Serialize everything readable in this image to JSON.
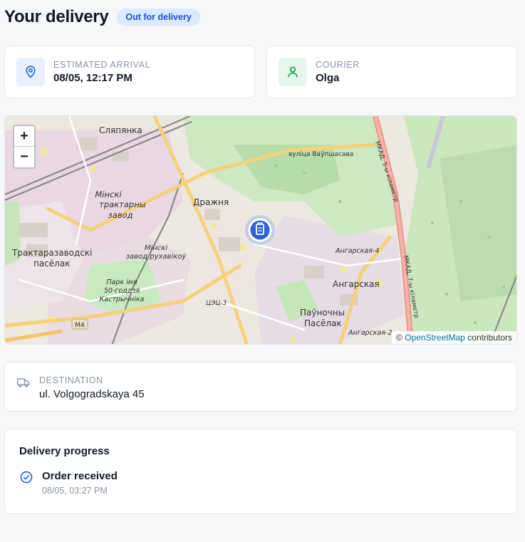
{
  "header": {
    "title": "Your delivery",
    "status": "Out for delivery"
  },
  "arrival": {
    "label": "ESTIMATED ARRIVAL",
    "value": "08/05, 12:17 PM",
    "icon": "map-pin-icon"
  },
  "courier": {
    "label": "COURIER",
    "value": "Olga",
    "icon": "user-icon"
  },
  "map": {
    "zoom_in": "+",
    "zoom_out": "−",
    "attribution_prefix": "©",
    "attribution_link": "OpenStreetMap",
    "attribution_suffix": "contributors",
    "labels": {
      "slyapyanka": "Сляпянка",
      "street": "вуліца Ваўпшасава",
      "mkad5": "МКАД, 5-ы кіламетр",
      "mkad7": "МКАД, 7-ы кіламетр",
      "tractor1": "Мінскі",
      "tractor2": "трактарны",
      "tractor3": "завод",
      "drazhnia": "Дражня",
      "traktar1": "Трактаразаводскі",
      "traktar2": "пасёлак",
      "gear1": "Мінскі",
      "gear2": "завод рухавікоў",
      "park1": "Парк імя",
      "park2": "50-годдзя",
      "park3": "Кастрычніка",
      "tets": "ЦЭЦ-3",
      "angarskaya4": "Ангарская-4",
      "angarskaya": "Ангарская",
      "paunochny1": "Паўночны",
      "paunochny2": "Пасёлак",
      "angarskaya2": "Ангарская-2",
      "m4": "M4"
    },
    "marker_icon": "delivery-marker-icon"
  },
  "destination": {
    "label": "DESTINATION",
    "value": "ul. Volgogradskaya 45",
    "icon": "truck-icon"
  },
  "progress": {
    "title": "Delivery progress",
    "steps": [
      {
        "label": "Order received",
        "time": "08/05, 03:27 PM",
        "icon": "check-circle-icon"
      }
    ]
  },
  "colors": {
    "accent": "#1d4ed8",
    "badge_bg": "#dbeafe",
    "courier_green": "#16a34a"
  }
}
